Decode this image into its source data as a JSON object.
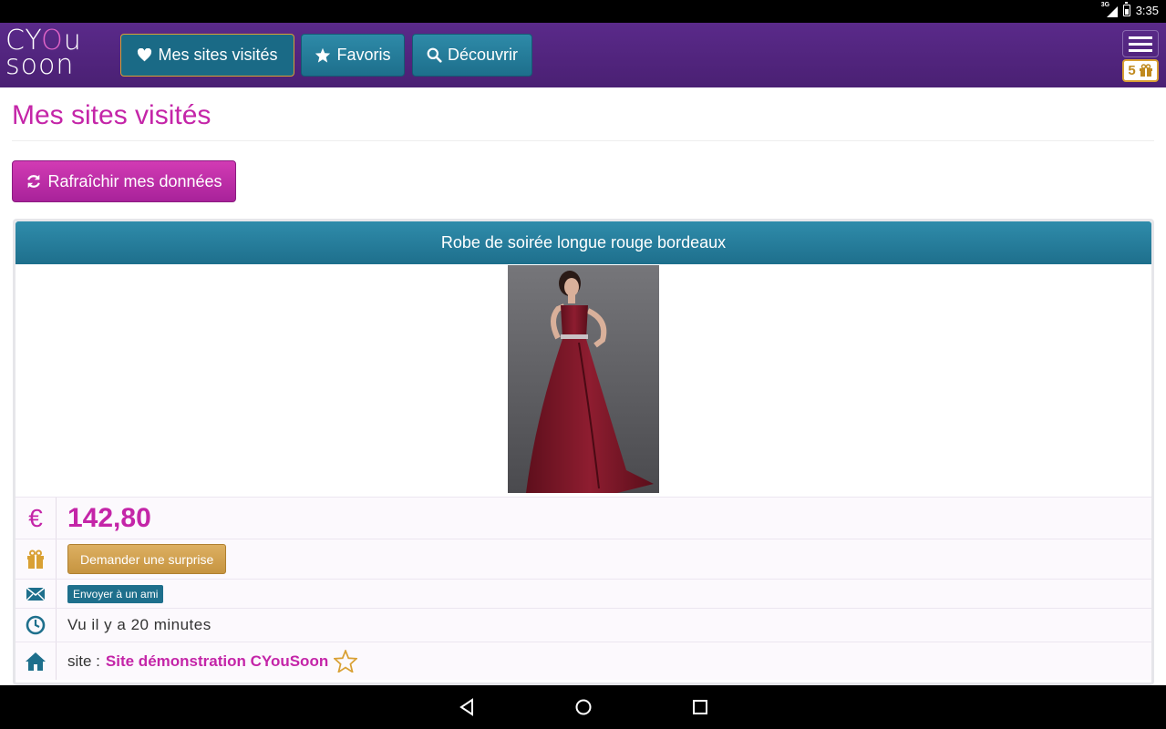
{
  "status_bar": {
    "network": "3G",
    "time": "3:35"
  },
  "header": {
    "logo_line1": "CY",
    "logo_o": "O",
    "logo_line1_end": "u",
    "logo_line2": "soon",
    "nav": [
      {
        "label": "Mes sites visités",
        "icon": "heart-icon"
      },
      {
        "label": "Favoris",
        "icon": "star-icon"
      },
      {
        "label": "Découvrir",
        "icon": "search-icon"
      }
    ],
    "gift_count": "5"
  },
  "main": {
    "title": "Mes sites visités",
    "refresh_label": "Rafraîchir mes données"
  },
  "product": {
    "name": "Robe de soirée longue rouge bordeaux",
    "currency": "€",
    "price": "142,80",
    "surprise_label": "Demander une surprise",
    "send_friend_label": "Envoyer à un ami",
    "seen": "Vu il y a 20 minutes",
    "site_prefix": "site :",
    "site_name": "Site démonstration CYouSoon"
  },
  "colors": {
    "brand_purple": "#4a2073",
    "accent_magenta": "#c425a8",
    "teal": "#1e6f8c",
    "gold": "#d9a033"
  }
}
